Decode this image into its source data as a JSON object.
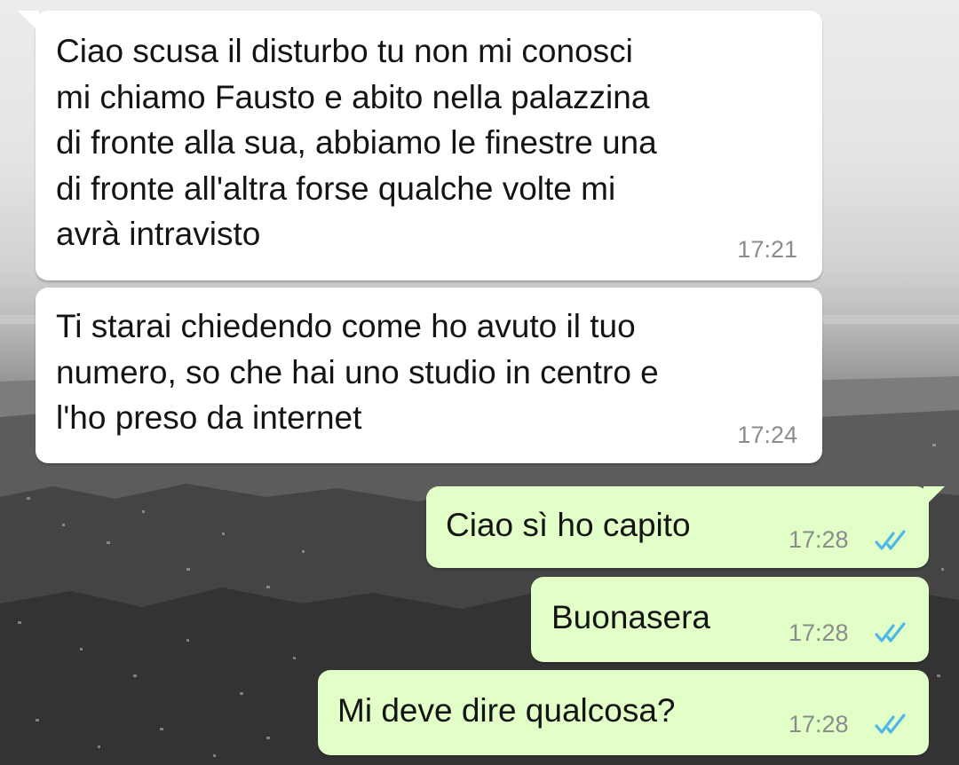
{
  "chat": {
    "colors": {
      "incoming_bubble": "#ffffff",
      "outgoing_bubble": "#e1ffc7",
      "read_ticks": "#4fb6ec",
      "timestamp": "#8c8c8c"
    },
    "messages": [
      {
        "direction": "incoming",
        "text": "Ciao scusa il disturbo tu non mi conosci\nmi chiamo Fausto e abito nella palazzina\ndi fronte alla sua, abbiamo le finestre una\ndi fronte all'altra forse qualche volte mi\navrà intravisto",
        "time": "17:21"
      },
      {
        "direction": "incoming",
        "text": "Ti starai chiedendo come ho avuto il tuo\nnumero, so che hai uno studio in centro e\nl'ho preso da internet",
        "time": "17:24"
      },
      {
        "direction": "outgoing",
        "text": "Ciao sì ho capito",
        "time": "17:28",
        "status_icon": "double-check-read-icon"
      },
      {
        "direction": "outgoing",
        "text": "Buonasera",
        "time": "17:28",
        "status_icon": "double-check-read-icon"
      },
      {
        "direction": "outgoing",
        "text": "Mi deve dire qualcosa?",
        "time": "17:28",
        "status_icon": "double-check-read-icon"
      }
    ]
  }
}
